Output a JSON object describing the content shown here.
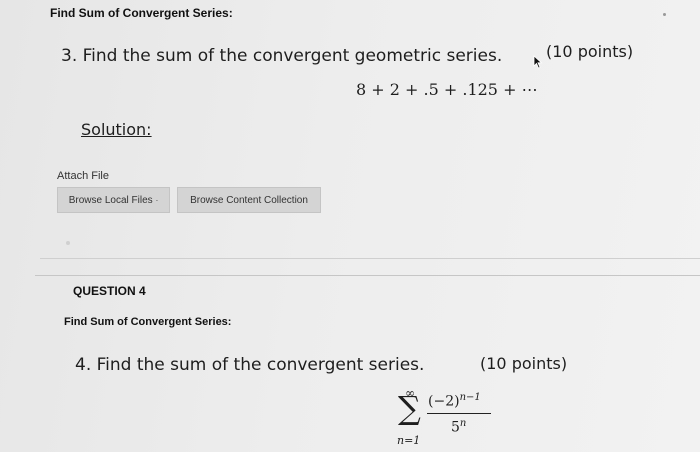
{
  "q3": {
    "header": "Find Sum of Convergent Series:",
    "prompt": "3. Find the sum of the convergent geometric series.",
    "points": "(10 points)",
    "series": "8 + 2 + .5 + .125 + ⋯",
    "solution_label": "Solution:",
    "attach_label": "Attach File",
    "browse_local": "Browse Local Files",
    "browse_content": "Browse Content Collection"
  },
  "q4": {
    "number_label": "QUESTION 4",
    "header": "Find Sum of Convergent Series:",
    "prompt": "4. Find the sum of the convergent series.",
    "points": "(10 points)",
    "sum_upper": "∞",
    "sum_symbol": "∑",
    "sum_lower": "n=1",
    "numerator_base": "(−2)",
    "numerator_exp": "n−1",
    "denominator_base": "5",
    "denominator_exp": "n"
  }
}
